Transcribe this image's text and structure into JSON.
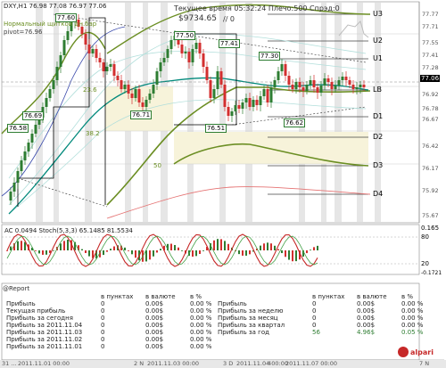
{
  "chart_header": {
    "symbol_line": "DXY,H1  76.98 77.08 76.97 77.06",
    "subtitle_1": "Нормальный щиткой дн.бар",
    "subtitle_2": "pivot=76.96",
    "server_time_label": "Текущее время 05:32:24 Плечо:500 Спрэд:0",
    "balance_label": "$9734.65",
    "balance_suffix": "// 0"
  },
  "price_axis": {
    "labels": [
      "77.77",
      "77.71",
      "77.55",
      "77.41",
      "77.28",
      "77.06",
      "76.92",
      "76.78",
      "76.67",
      "76.42",
      "76.17",
      "75.92",
      "75.67"
    ],
    "current_price": "77.06"
  },
  "levels": [
    {
      "name": "U3",
      "color": "#222222"
    },
    {
      "name": "U2",
      "color": "#222222"
    },
    {
      "name": "U1",
      "color": "#222222"
    },
    {
      "name": "LB",
      "color": "#222222"
    },
    {
      "name": "D1",
      "color": "#222222"
    },
    {
      "name": "D2",
      "color": "#222222"
    },
    {
      "name": "D3",
      "color": "#222222"
    },
    {
      "name": "D4",
      "color": "#222222"
    }
  ],
  "price_labels": [
    "77.60",
    "77.50",
    "77.41",
    "77.30",
    "76.69",
    "76.58",
    "76.71",
    "76.51",
    "76.62"
  ],
  "fib_labels": [
    "23.6",
    "38.2",
    "50"
  ],
  "indicator": {
    "label": "AC 0.0494  Stoch(5,3,3) 65.1485 81.5534",
    "axis_labels": [
      "0.165",
      "80",
      "20",
      "-0.1721"
    ]
  },
  "time_axis": {
    "labels": [
      "31 ...",
      "2011.11.01 00:00",
      "2 N",
      "2011.11.03 00:00",
      "3 D",
      "2011.11.04 00:00",
      "4",
      "2011.11.07 00:00",
      "7 N"
    ]
  },
  "report": {
    "title": "@Report",
    "headers": [
      "в пунктах",
      "в валюте",
      "в %"
    ],
    "left_rows": [
      {
        "label": "Прибыль",
        "pts": "0",
        "cur": "0.00$",
        "pct": "0.00 %"
      },
      {
        "label": "Текущая прибыль",
        "pts": "0",
        "cur": "0.00$",
        "pct": "0.00 %"
      },
      {
        "label": "Прибыль за сегодня",
        "pts": "0",
        "cur": "0.00$",
        "pct": "0.00 %"
      },
      {
        "label": "Прибыль за 2011.11.04",
        "pts": "0",
        "cur": "0.00$",
        "pct": "0.00 %"
      },
      {
        "label": "Прибыль за 2011.11.03",
        "pts": "0",
        "cur": "0.00$",
        "pct": "0.00 %"
      },
      {
        "label": "Прибыль за 2011.11.02",
        "pts": "0",
        "cur": "0.00$",
        "pct": "0.00 %"
      },
      {
        "label": "Прибыль за 2011.11.01",
        "pts": "0",
        "cur": "0.00$",
        "pct": "0.00 %"
      }
    ],
    "right_rows": [
      {
        "label": "Прибыль",
        "pts": "0",
        "cur": "0.00$",
        "pct": "0.00 %"
      },
      {
        "label": "Прибыль за неделю",
        "pts": "0",
        "cur": "0.00$",
        "pct": "0.00 %"
      },
      {
        "label": "Прибыль за месяц",
        "pts": "0",
        "cur": "0.00$",
        "pct": "0.00 %"
      },
      {
        "label": "Прибыль за квартал",
        "pts": "0",
        "cur": "0.00$",
        "pct": "0.00 %"
      },
      {
        "label": "Прибыль за год",
        "pts": "56",
        "cur": "4.96$",
        "pct": "0.05 %"
      }
    ],
    "logo_text": "alpari"
  },
  "colors": {
    "bull_candle": "#2e7d32",
    "bear_candle": "#d32f2f",
    "ma_fast": "#00897b",
    "ma_slow": "#558b2f",
    "zone_fill": "#f7f3da",
    "gray_band": "#e8e8e8"
  }
}
